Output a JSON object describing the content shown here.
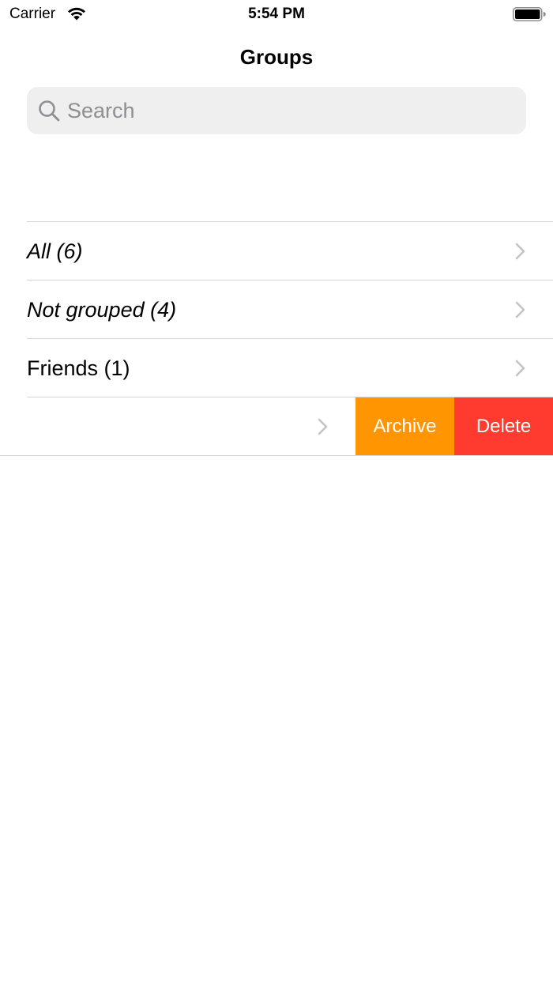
{
  "status_bar": {
    "carrier": "Carrier",
    "time": "5:54 PM"
  },
  "nav": {
    "title": "Groups"
  },
  "search": {
    "placeholder": "Search",
    "value": ""
  },
  "groups": [
    {
      "label": "All (6)",
      "italic": true
    },
    {
      "label": "Not grouped (4)",
      "italic": true
    },
    {
      "label": "Friends (1)",
      "italic": false
    }
  ],
  "swiped_row": {
    "label": "",
    "actions": {
      "archive": "Archive",
      "delete": "Delete"
    }
  },
  "colors": {
    "archive": "#ff9500",
    "delete": "#ff3b30",
    "chevron": "#c4c4c7",
    "search_bg": "#efeff0",
    "separator": "#d4d4d6"
  }
}
